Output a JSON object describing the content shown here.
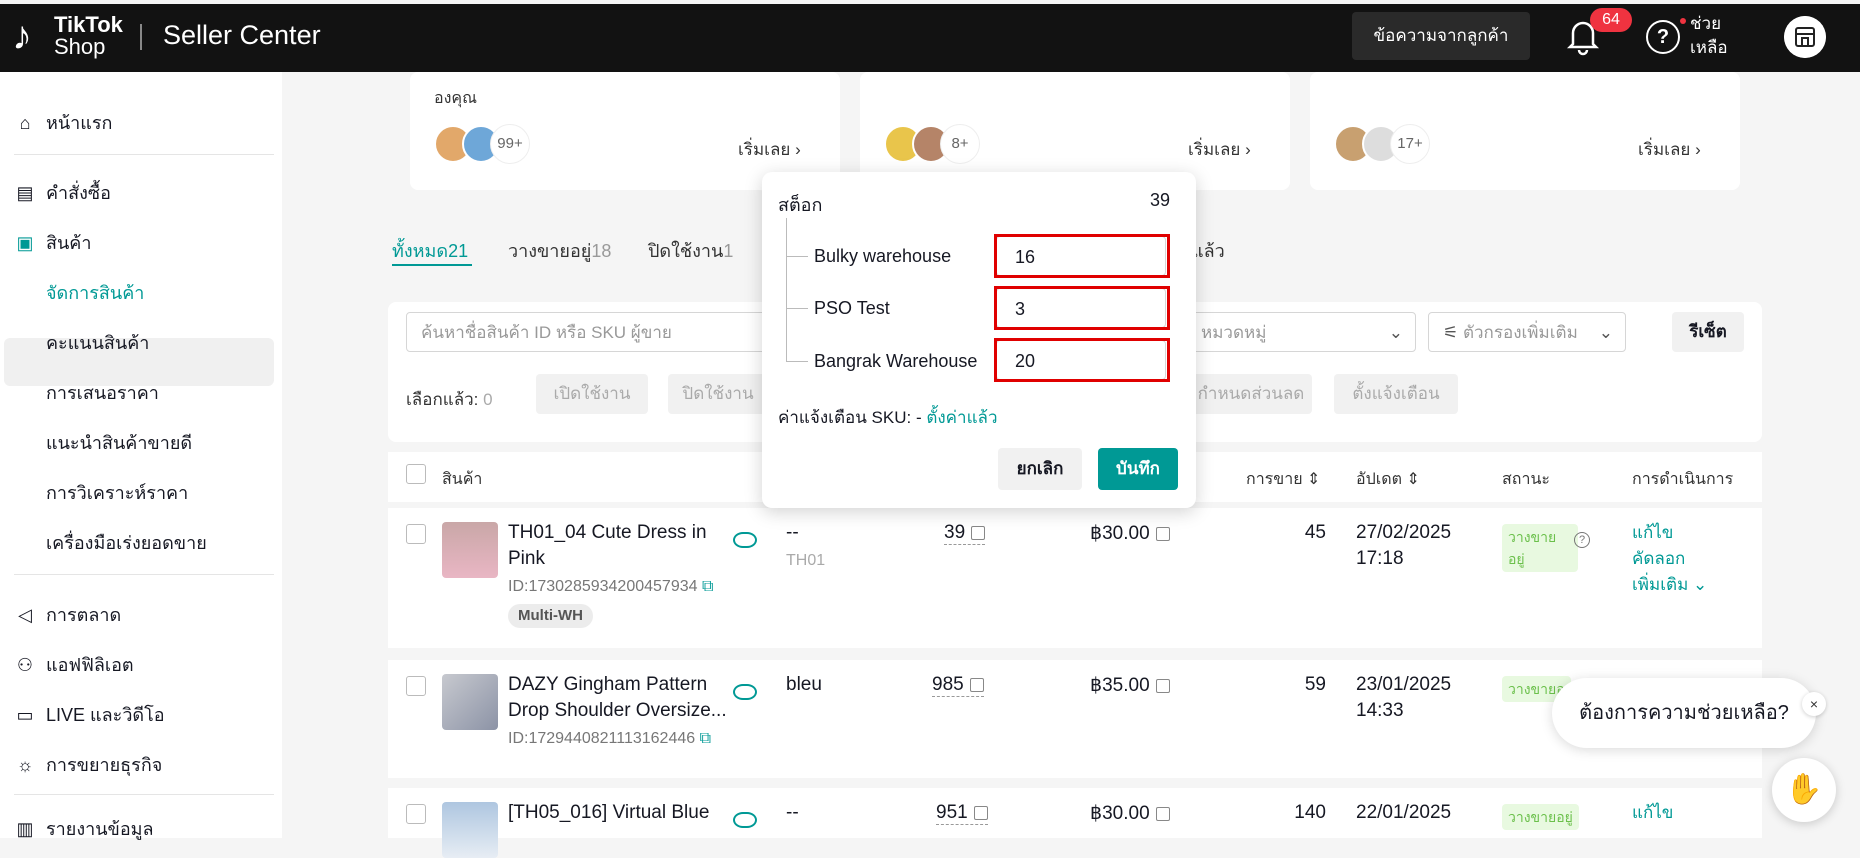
{
  "header": {
    "logo_line1": "TikTok",
    "logo_line2": "Shop",
    "title": "Seller Center",
    "message_button": "ข้อความจากลูกค้า",
    "notification_count": "64",
    "help_label": "ช่วยเหลือ"
  },
  "sidebar": {
    "items": [
      {
        "label": "หน้าแรก",
        "icon": "home-icon"
      },
      {
        "label": "คำสั่งซื้อ",
        "icon": "clipboard-icon"
      },
      {
        "label": "สินค้า",
        "icon": "product-icon"
      },
      {
        "label": "การตลาด",
        "icon": "megaphone-icon"
      },
      {
        "label": "แอฟฟิลิเอต",
        "icon": "users-icon"
      },
      {
        "label": "LIVE และวิดีโอ",
        "icon": "video-icon"
      },
      {
        "label": "การขยายธุรกิจ",
        "icon": "growth-icon"
      },
      {
        "label": "รายงานข้อมูล",
        "icon": "chart-icon"
      }
    ],
    "sub_items": [
      "จัดการสินค้า",
      "คะแนนสินค้า",
      "การเสนอราคา",
      "แนะนำสินค้าขายดี",
      "การวิเคราะห์ราคา",
      "เครื่องมือเร่งยอดขาย"
    ]
  },
  "cards": [
    {
      "desc": "องคุณ",
      "count": "99+",
      "start": "เริ่มเลย"
    },
    {
      "desc": "",
      "count": "8+",
      "start": "เริ่มเลย"
    },
    {
      "desc": "",
      "count": "17+",
      "start": "เริ่มเลย"
    }
  ],
  "tabs": [
    {
      "label": "ทั้งหมด",
      "count": "21"
    },
    {
      "label": "วางขายอยู่",
      "count": "18"
    },
    {
      "label": "ปิดใช้งาน",
      "count": "1"
    },
    {
      "label": "แล้ว",
      "count": ""
    }
  ],
  "filters": {
    "search_placeholder": "ค้นหาชื่อสินค้า ID หรือ SKU ผู้ขาย",
    "category_placeholder": "หมวดหมู่",
    "more_filters": "ตัวกรองเพิ่มเติม",
    "reset": "รีเซ็ต",
    "selected_label": "เลือกแล้ว:",
    "selected_count": "0",
    "activate": "เปิดใช้งาน",
    "deactivate": "ปิดใช้งาน",
    "set_discount": "กำหนดส่วนลด",
    "set_alert": "ตั้งแจ้งเตือน"
  },
  "table": {
    "headers": {
      "product": "สินค้า",
      "sales": "การขาย",
      "updated": "อัปเดต",
      "status": "สถานะ",
      "actions": "การดำเนินการ"
    },
    "rows": [
      {
        "name": "TH01_04 Cute Dress in Pink",
        "id": "ID:1730285934200457934",
        "tag": "Multi-WH",
        "sku": "--",
        "sku2": "TH01",
        "stock": "39",
        "price": "฿30.00",
        "sales": "45",
        "date": "27/02/2025",
        "time": "17:18",
        "status": "วางขายอยู่",
        "edit": "แก้ไข",
        "copy": "คัดลอก",
        "more": "เพิ่มเติม"
      },
      {
        "name": "DAZY Gingham Pattern Drop Shoulder Oversize...",
        "id": "ID:1729440821113162446",
        "tag": "",
        "sku": "bleu",
        "sku2": "",
        "stock": "985",
        "price": "฿35.00",
        "sales": "59",
        "date": "23/01/2025",
        "time": "14:33",
        "status": "วางขายอ",
        "edit": "",
        "copy": "",
        "more": ""
      },
      {
        "name": "[TH05_016] Virtual Blue",
        "id": "",
        "tag": "",
        "sku": "--",
        "sku2": "",
        "stock": "951",
        "price": "฿30.00",
        "sales": "140",
        "date": "22/01/2025",
        "time": "",
        "status": "วางขายอยู่",
        "edit": "แก้ไข",
        "copy": "",
        "more": ""
      }
    ]
  },
  "popup": {
    "title": "สต็อก",
    "total": "39",
    "warehouses": [
      {
        "name": "Bulky warehouse",
        "qty": "16"
      },
      {
        "name": "PSO Test",
        "qty": "3"
      },
      {
        "name": "Bangrak Warehouse",
        "qty": "20"
      }
    ],
    "alert_label": "ค่าแจ้งเตือน SKU: -",
    "alert_link": "ตั้งค่าแล้ว",
    "cancel": "ยกเลิก",
    "save": "บันทึก"
  },
  "chat": {
    "prompt": "ต้องการความช่วยเหลือ?",
    "close": "×"
  },
  "colors": {
    "accent": "#009995",
    "header_bg": "#121212",
    "alert": "#ef3340",
    "highlight": "#e00000"
  }
}
